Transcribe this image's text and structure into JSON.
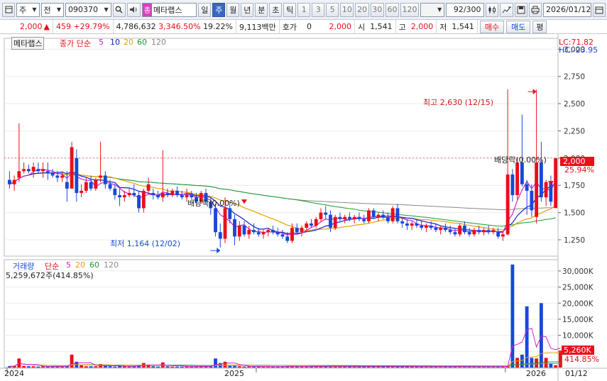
{
  "toolbar": {
    "type_select": "주",
    "market_select": "전",
    "code": "090370",
    "name": "메타랩스",
    "name_badge": "종",
    "periods": [
      "일",
      "주",
      "월",
      "년",
      "분",
      "초",
      "틱"
    ],
    "active_period": "주",
    "intervals": [
      "1",
      "3",
      "5",
      "10",
      "20",
      "30",
      "60",
      "120"
    ],
    "count": "92/300",
    "date": "2026/01/12"
  },
  "quote": {
    "price": "2,000",
    "change": "459",
    "change_pct": "+29.79%",
    "volume": "4,786,632",
    "volume_ratio": "3,346.50%",
    "turnover": "19.22%",
    "amount": "9,113백만",
    "hoga_label": "호가",
    "hoga_value": "0",
    "ask": "2,000",
    "open_label": "시",
    "open": "1,541",
    "high_label": "고",
    "high": "2,000",
    "low_label": "저",
    "low": "1,541",
    "buy_label": "매수",
    "sell_label": "매도",
    "eval_label": "평"
  },
  "price_panel": {
    "name_tag": "메타랩스",
    "ma_title": "종가 단순",
    "ma_periods": [
      {
        "label": "5",
        "color": "#d020d0"
      },
      {
        "label": "10",
        "color": "#1020c0"
      },
      {
        "label": "20",
        "color": "#e8a000"
      },
      {
        "label": "60",
        "color": "#1a9a30"
      },
      {
        "label": "120",
        "color": "#888888"
      }
    ],
    "lc": "LC:71.82",
    "hc": "HC:-23.95",
    "current_price_tag": "2,000",
    "current_pct_tag": "25.94%",
    "high_annotation": "최고 2,630 (12/15)",
    "low_annotation": "최저 1,164 (12/02)",
    "dividend_annotations": [
      "배당락(0.00%)",
      "배당락(0.00%)"
    ],
    "y_ticks": [
      "3,000",
      "2,750",
      "2,500",
      "2,250",
      "2,000",
      "1,750",
      "1,500",
      "1,250"
    ]
  },
  "volume_panel": {
    "title": "거래량",
    "ma_title": "단순",
    "ma_periods": [
      {
        "label": "5",
        "color": "#d020d0"
      },
      {
        "label": "20",
        "color": "#e8a000"
      },
      {
        "label": "60",
        "color": "#1a9a30"
      },
      {
        "label": "120",
        "color": "#888888"
      }
    ],
    "current_text": "5,259,672주(414.85%)",
    "y_ticks": [
      "30,000K",
      "25,000K",
      "20,000K",
      "15,000K",
      "10,000K",
      "5,000K"
    ],
    "current_tag": "5,260K",
    "current_pct_tag": "414.85%"
  },
  "x_axis": {
    "labels": [
      "2024",
      "2025",
      "2026"
    ],
    "last_date": "01/12"
  },
  "colors": {
    "up": "#e8101a",
    "down": "#1848d8",
    "accent": "#3a67c0"
  },
  "chart_data": {
    "type": "candlestick",
    "interval": "week",
    "ylim": [
      1100,
      3100
    ],
    "candles": [
      [
        1800,
        1880,
        1720,
        1760
      ],
      [
        1760,
        1840,
        1700,
        1800
      ],
      [
        1820,
        2320,
        1780,
        1880
      ],
      [
        1880,
        1960,
        1860,
        1900
      ],
      [
        1900,
        1940,
        1860,
        1880
      ],
      [
        1880,
        1960,
        1820,
        1920
      ],
      [
        1900,
        1960,
        1860,
        1880
      ],
      [
        1880,
        1960,
        1820,
        1900
      ],
      [
        1880,
        1960,
        1800,
        1860
      ],
      [
        1860,
        1900,
        1820,
        1840
      ],
      [
        1840,
        1880,
        1780,
        1820
      ],
      [
        1820,
        1880,
        1780,
        1840
      ],
      [
        1780,
        1880,
        1600,
        1720
      ],
      [
        1720,
        2150,
        1720,
        2100
      ],
      [
        2000,
        2080,
        1600,
        1680
      ],
      [
        1680,
        1760,
        1640,
        1700
      ],
      [
        1700,
        1820,
        1680,
        1780
      ],
      [
        1780,
        1840,
        1700,
        1720
      ],
      [
        1720,
        1820,
        1700,
        1800
      ],
      [
        1820,
        2150,
        1780,
        1840
      ],
      [
        1840,
        1880,
        1720,
        1760
      ],
      [
        1760,
        1800,
        1700,
        1720
      ],
      [
        1720,
        1760,
        1620,
        1660
      ],
      [
        1660,
        1720,
        1560,
        1640
      ],
      [
        1640,
        1700,
        1600,
        1660
      ],
      [
        1660,
        1720,
        1640,
        1680
      ],
      [
        1680,
        1760,
        1640,
        1660
      ],
      [
        1660,
        1700,
        1500,
        1540
      ],
      [
        1540,
        1720,
        1500,
        1700
      ],
      [
        1700,
        1820,
        1680,
        1760
      ],
      [
        1680,
        1720,
        1620,
        1660
      ],
      [
        1660,
        1700,
        1620,
        1640
      ],
      [
        1640,
        2070,
        1600,
        1680
      ],
      [
        1680,
        1720,
        1640,
        1660
      ],
      [
        1660,
        1720,
        1640,
        1700
      ],
      [
        1700,
        1740,
        1640,
        1660
      ],
      [
        1660,
        1700,
        1620,
        1640
      ],
      [
        1640,
        1720,
        1600,
        1660
      ],
      [
        1660,
        1700,
        1620,
        1640
      ],
      [
        1640,
        1680,
        1580,
        1600
      ],
      [
        1600,
        1700,
        1580,
        1680
      ],
      [
        1680,
        1720,
        1580,
        1600
      ],
      [
        1600,
        1640,
        1480,
        1540
      ],
      [
        1540,
        1580,
        1280,
        1320
      ],
      [
        1320,
        1400,
        1180,
        1260
      ],
      [
        1260,
        1640,
        1220,
        1540
      ],
      [
        1540,
        1600,
        1400,
        1440
      ],
      [
        1440,
        1480,
        1200,
        1280
      ],
      [
        1280,
        1420,
        1240,
        1380
      ],
      [
        1380,
        1420,
        1280,
        1300
      ],
      [
        1300,
        1380,
        1260,
        1340
      ],
      [
        1340,
        1400,
        1300,
        1320
      ],
      [
        1320,
        1360,
        1280,
        1300
      ],
      [
        1300,
        1340,
        1260,
        1320
      ],
      [
        1320,
        1360,
        1280,
        1340
      ],
      [
        1340,
        1380,
        1300,
        1320
      ],
      [
        1320,
        1360,
        1280,
        1300
      ],
      [
        1300,
        1340,
        1260,
        1280
      ],
      [
        1280,
        1320,
        1220,
        1240
      ],
      [
        1240,
        1400,
        1220,
        1360
      ],
      [
        1360,
        1400,
        1300,
        1320
      ],
      [
        1320,
        1380,
        1280,
        1360
      ],
      [
        1360,
        1420,
        1340,
        1400
      ],
      [
        1400,
        1440,
        1360,
        1380
      ],
      [
        1380,
        1460,
        1360,
        1440
      ],
      [
        1440,
        1540,
        1420,
        1500
      ],
      [
        1500,
        1560,
        1440,
        1480
      ],
      [
        1480,
        1520,
        1320,
        1360
      ],
      [
        1360,
        1480,
        1340,
        1460
      ],
      [
        1460,
        1500,
        1420,
        1440
      ],
      [
        1440,
        1480,
        1400,
        1460
      ],
      [
        1460,
        1500,
        1420,
        1440
      ],
      [
        1440,
        1480,
        1400,
        1460
      ],
      [
        1460,
        1500,
        1420,
        1440
      ],
      [
        1440,
        1480,
        1400,
        1420
      ],
      [
        1420,
        1540,
        1400,
        1520
      ],
      [
        1520,
        1540,
        1440,
        1460
      ],
      [
        1460,
        1500,
        1420,
        1480
      ],
      [
        1480,
        1520,
        1440,
        1460
      ],
      [
        1460,
        1500,
        1400,
        1420
      ],
      [
        1420,
        1560,
        1400,
        1540
      ],
      [
        1540,
        1580,
        1400,
        1420
      ],
      [
        1420,
        1460,
        1360,
        1400
      ],
      [
        1400,
        1440,
        1340,
        1380
      ],
      [
        1380,
        1420,
        1340,
        1400
      ],
      [
        1400,
        1440,
        1360,
        1380
      ],
      [
        1380,
        1420,
        1340,
        1360
      ],
      [
        1360,
        1400,
        1320,
        1380
      ],
      [
        1380,
        1420,
        1340,
        1360
      ],
      [
        1360,
        1400,
        1320,
        1340
      ],
      [
        1340,
        1380,
        1300,
        1360
      ],
      [
        1360,
        1400,
        1320,
        1340
      ],
      [
        1340,
        1380,
        1300,
        1320
      ],
      [
        1320,
        1360,
        1280,
        1300
      ],
      [
        1300,
        1400,
        1280,
        1380
      ],
      [
        1380,
        1420,
        1300,
        1320
      ],
      [
        1320,
        1360,
        1280,
        1300
      ],
      [
        1300,
        1360,
        1280,
        1340
      ],
      [
        1340,
        1380,
        1300,
        1320
      ],
      [
        1320,
        1360,
        1290,
        1340
      ],
      [
        1340,
        1380,
        1300,
        1320
      ],
      [
        1320,
        1360,
        1300,
        1340
      ],
      [
        1320,
        1360,
        1260,
        1280
      ],
      [
        1280,
        1320,
        1240,
        1300
      ],
      [
        1300,
        2630,
        1290,
        1850
      ],
      [
        1850,
        1900,
        1600,
        1660
      ],
      [
        1660,
        2000,
        1620,
        1960
      ],
      [
        1960,
        2400,
        1740,
        1760
      ],
      [
        1760,
        1800,
        1480,
        1700
      ],
      [
        1700,
        1760,
        1460,
        1520
      ],
      [
        1460,
        2630,
        1400,
        1960
      ],
      [
        1960,
        2150,
        1600,
        1640
      ],
      [
        1640,
        1800,
        1560,
        1780
      ],
      [
        1780,
        1840,
        1560,
        1600
      ],
      [
        1541,
        2000,
        1541,
        2000
      ]
    ],
    "volumes_k": [
      400,
      500,
      2800,
      500,
      400,
      400,
      300,
      400,
      300,
      300,
      300,
      300,
      600,
      4000,
      1800,
      700,
      400,
      400,
      400,
      1100,
      500,
      400,
      300,
      500,
      400,
      300,
      400,
      700,
      1400,
      900,
      400,
      300,
      1600,
      400,
      300,
      300,
      300,
      300,
      300,
      300,
      400,
      300,
      500,
      2800,
      1400,
      1800,
      500,
      500,
      400,
      300,
      300,
      300,
      300,
      300,
      300,
      300,
      300,
      300,
      400,
      500,
      300,
      300,
      300,
      300,
      300,
      400,
      400,
      500,
      300,
      300,
      300,
      300,
      300,
      300,
      300,
      400,
      300,
      300,
      300,
      300,
      400,
      300,
      300,
      300,
      300,
      300,
      300,
      300,
      300,
      300,
      300,
      300,
      300,
      300,
      300,
      300,
      300,
      300,
      300,
      300,
      300,
      300,
      300,
      300,
      400,
      32000,
      3000,
      4000,
      19000,
      3000,
      2800,
      20000,
      3000,
      1200,
      700,
      5260
    ]
  }
}
